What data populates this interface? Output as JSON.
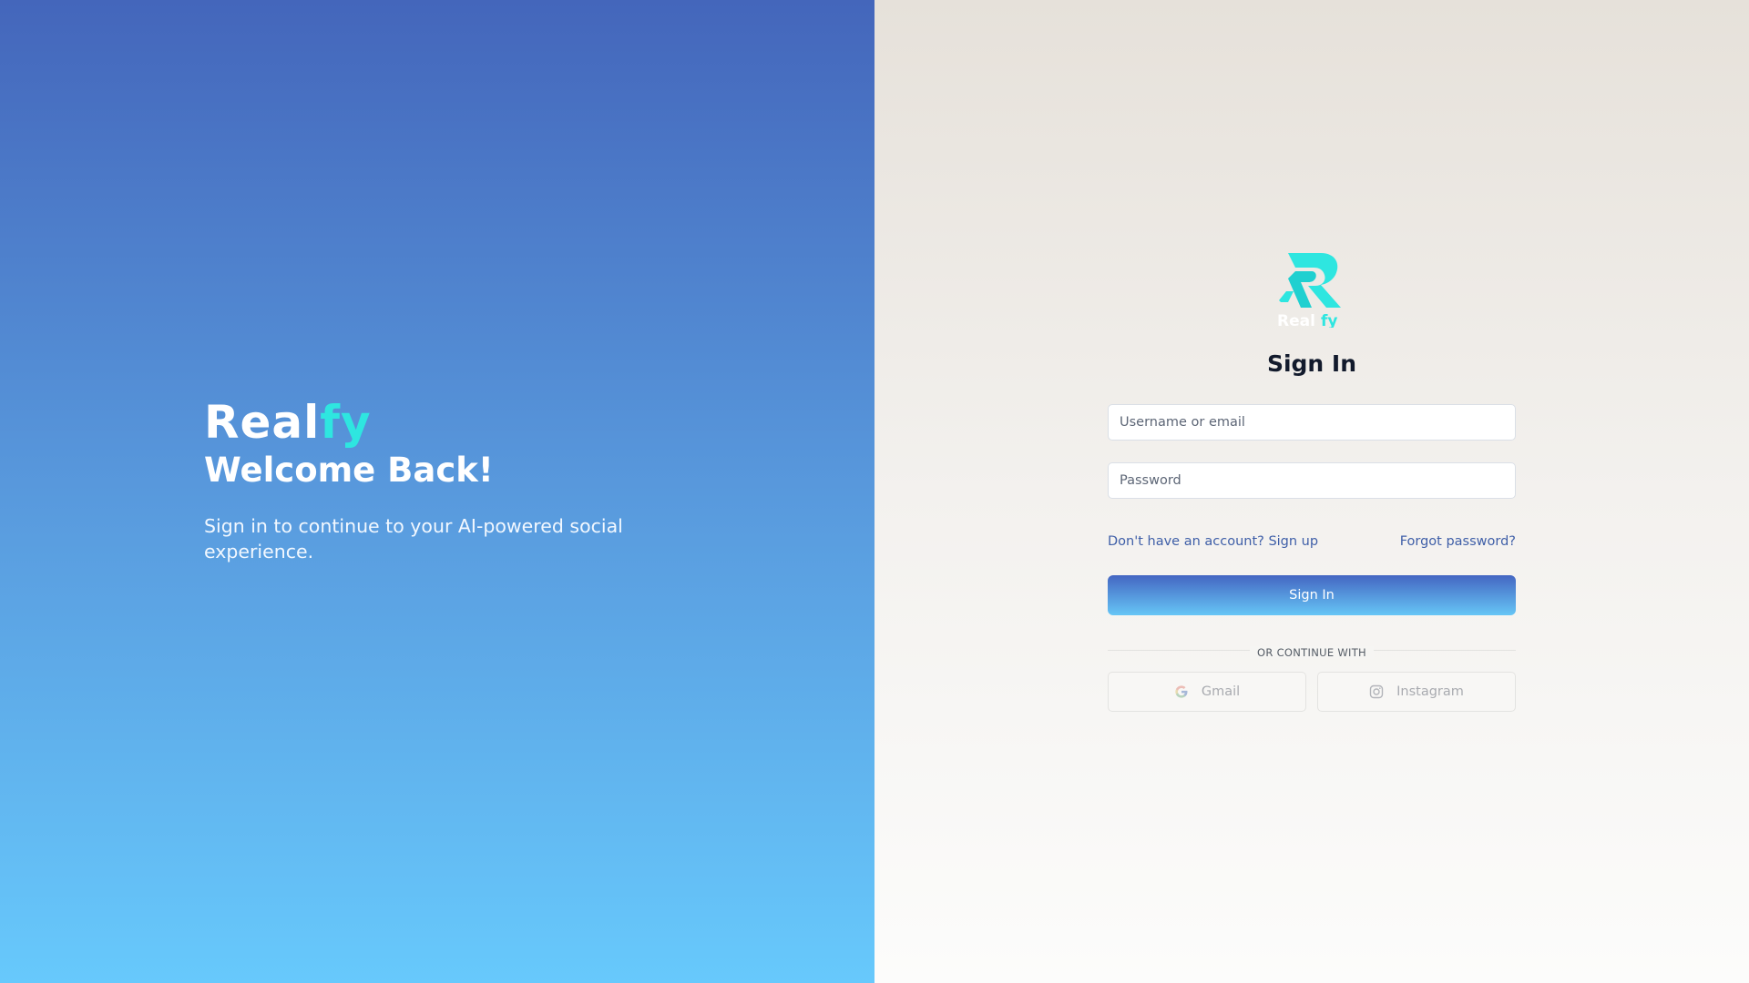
{
  "left": {
    "brand_main": "Real",
    "brand_accent": "fy",
    "welcome": "Welcome Back!",
    "tagline": "Sign in to continue to your AI-powered social experience."
  },
  "form": {
    "logo_text": "Realfy",
    "title": "Sign In",
    "username_placeholder": "Username or email",
    "password_placeholder": "Password",
    "signup_link": "Don't have an account? Sign up",
    "forgot_link": "Forgot password?",
    "submit_label": "Sign In",
    "divider_text": "OR CONTINUE WITH",
    "social": {
      "gmail_label": "Gmail",
      "gmail_icon": "google-icon",
      "instagram_label": "Instagram",
      "instagram_icon": "instagram-icon"
    }
  },
  "colors": {
    "accent_cyan": "#2ee6e0",
    "gradient_top": "#4466bb",
    "gradient_bottom": "#67c9fc",
    "link": "#3f5fa8"
  }
}
